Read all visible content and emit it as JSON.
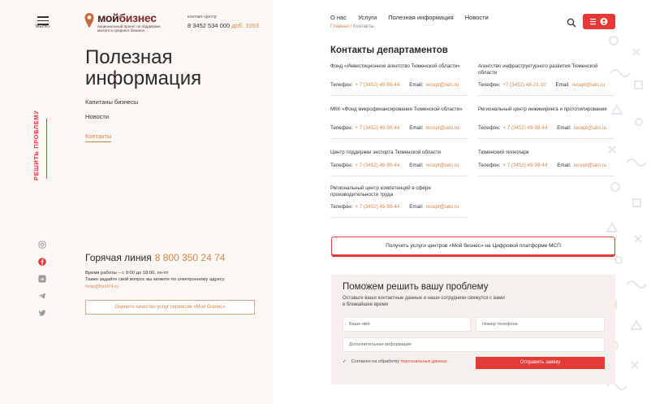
{
  "sidebar": {
    "menu_label": "МЕНЮ",
    "vertical_cta": "РЕШИТЬ ПРОБЛЕМУ",
    "socials": [
      "instagram-icon",
      "facebook-icon",
      "vk-icon",
      "telegram-icon",
      "twitter-icon"
    ]
  },
  "logo": {
    "word_a": "мой",
    "word_b": "бизнес",
    "subtitle": "национальный проект по поддержке малого и среднего бизнеса"
  },
  "contact_center": {
    "label": "контакт-центр",
    "phone": "8 3452 534 000",
    "ext": "доб. 1093"
  },
  "page": {
    "title": "Полезная информация",
    "subnav": [
      "Капитаны бизнесы",
      "Новости",
      "Контакты"
    ]
  },
  "hotline": {
    "title": "Горячая линия",
    "number": "8 800 350 24 74",
    "hours_line1": "Время работы – с 9:00 до 18:00, пн-пт",
    "hours_line2": "Также задайте свой вопрос вы можете по электронному адресу",
    "email": "help@fond74.ru",
    "rate_button": "Оцените качество услуг сервисом «Мой бизнес»"
  },
  "topnav": {
    "items": [
      "О нас",
      "Услуги",
      "Полезная информация",
      "Новости"
    ]
  },
  "breadcrumb": {
    "home": "Главная",
    "sep": " / ",
    "current": "Контакты"
  },
  "departments": {
    "title": "Контакты департаментов",
    "phone_label": "Телефон:",
    "email_label": "Email:",
    "items": [
      {
        "name": "Фонд «Инвестиционное агентство Тюменской области»",
        "phone": "+ 7 (3452) 49-99-44",
        "email": "recept@iato.ru"
      },
      {
        "name": "Агентство инфраструктурного развития Тюменской области",
        "phone": "+7 (3452) 48-23-10",
        "email": "recept@iato.ru"
      },
      {
        "name": "МКК «Фонд микрофинансирования Тюменской области»",
        "phone": "+ 7 (3452) 49-99-44",
        "email": "recept@iato.ru"
      },
      {
        "name": "Региональный центр инжиниринга и прототипирования",
        "phone": "+ 7 (3452) 49-99-44",
        "email": "recept@iato.ru"
      },
      {
        "name": "Центр поддержки экспорта Тюменской области",
        "phone": "+ 7 (3452) 49-99-44",
        "email": "recept@iato.ru"
      },
      {
        "name": "Тюменский технопарк",
        "phone": "+ 7 (3452) 49-99-44",
        "email": "recept@iato.ru"
      },
      {
        "name": "Региональный центр компетенций в сфере производительности труда",
        "phone": "+ 7 (3452) 49-99-44",
        "email": "recept@iato.ru"
      }
    ]
  },
  "cta": {
    "get_services": "Получить услуги центров «Мой бизнес» на Цифровой платформе МСП"
  },
  "help_form": {
    "title": "Поможем решить вашу проблему",
    "subtitle": "Оставьте ваши контактные данные и наши сотрудники свяжутся с вами в ближайшее время",
    "name_placeholder": "Ваше имя",
    "phone_placeholder": "Номер телефона",
    "extra_placeholder": "Дополнительная информация",
    "consent_text": "Согласен на обработку",
    "consent_link": "персональных данных",
    "submit": "Отправить заявку"
  },
  "colors": {
    "accent_red": "#e53935",
    "accent_orange": "#d9864a",
    "brand_brown": "#7a2828"
  }
}
